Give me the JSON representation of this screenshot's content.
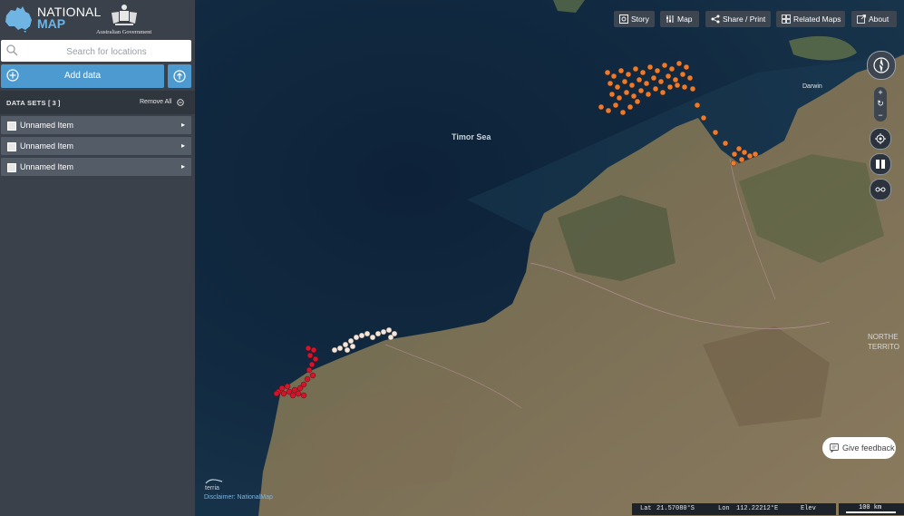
{
  "app": {
    "logo_line1": "NATIONAL",
    "logo_line2": "MAP",
    "gov_text": "Australian Government"
  },
  "sidebar": {
    "search_placeholder": "Search for locations",
    "add_data_label": "Add data",
    "datasets_title": "DATA SETS",
    "datasets_count": "[ 3 ]",
    "remove_all_label": "Remove All",
    "items": [
      {
        "label": "Unnamed Item"
      },
      {
        "label": "Unnamed Item"
      },
      {
        "label": "Unnamed Item"
      }
    ],
    "collapse_icon": "chevron-left-icon"
  },
  "toolbar": {
    "story": "Story",
    "map": "Map",
    "share": "Share / Print",
    "related": "Related Maps",
    "about": "About"
  },
  "map": {
    "labels": {
      "sea": "Timor Sea",
      "darwin": "Darwin",
      "nt_line1": "NORTHE",
      "nt_line2": "TERRITO"
    },
    "feedback": "Give feedback",
    "terria": "terria",
    "disclaimer": "Disclaimer: NationalMap",
    "status": {
      "lat_label": "Lat",
      "lat": "21.57080°S",
      "lon_label": "Lon",
      "lon": "112.22212°E",
      "elev_label": "Elev"
    },
    "scale_label": "100 km",
    "colors": {
      "orange_points": "#f07a2b",
      "red_points": "#d4142a",
      "white_points": "#f4e6dc",
      "accent": "#4d9ad1"
    }
  }
}
